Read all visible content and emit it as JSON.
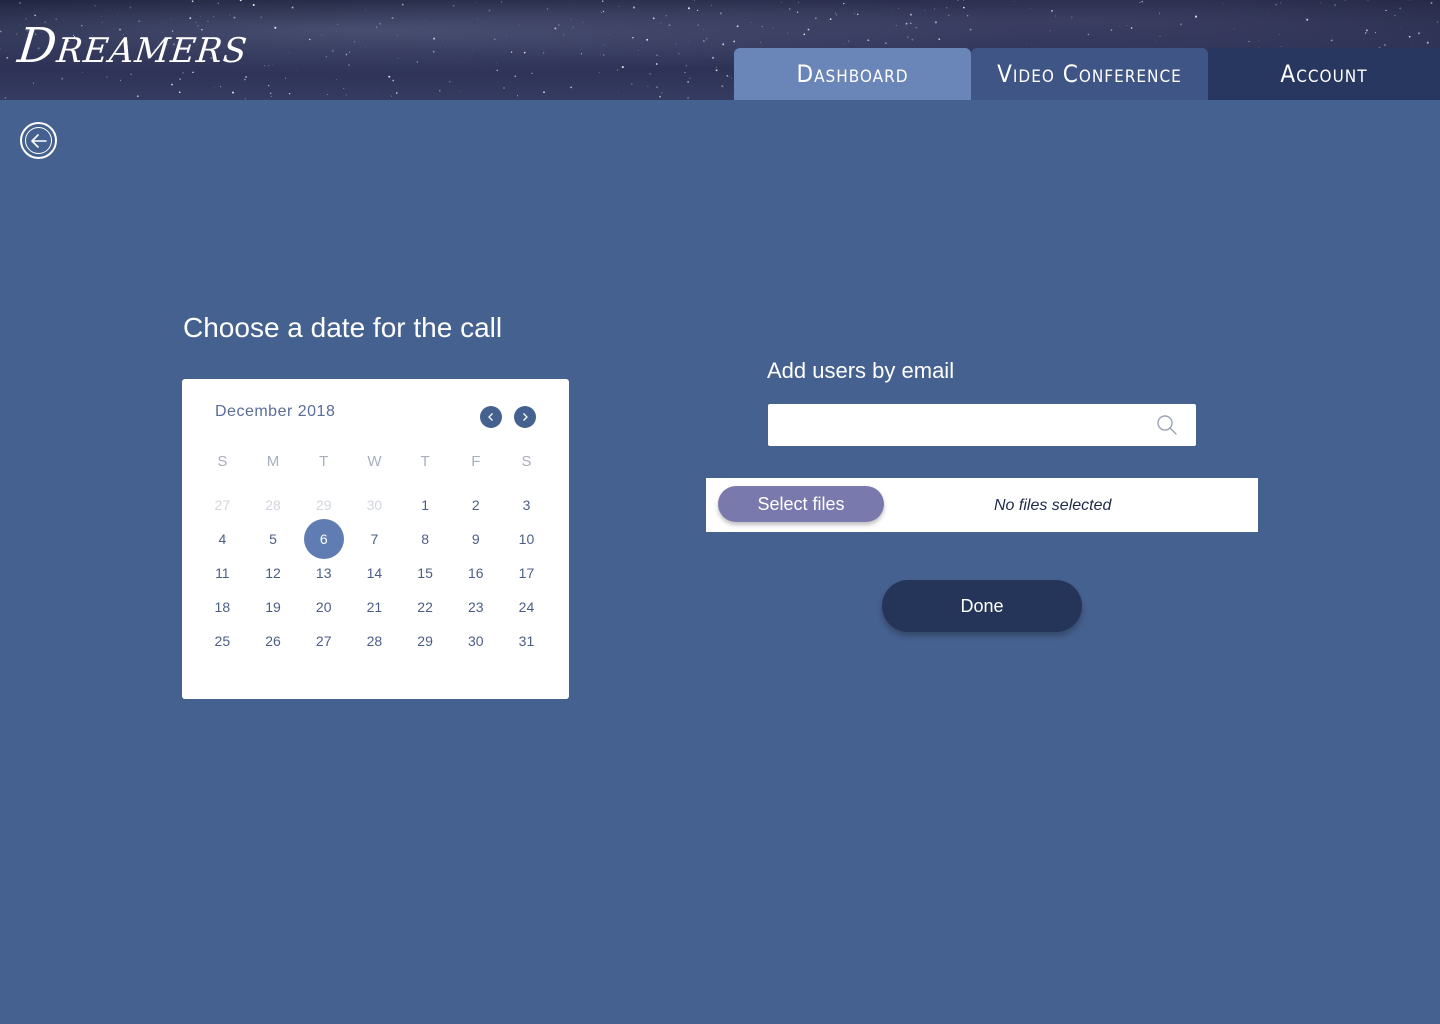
{
  "header": {
    "logo": "Dreamers",
    "nav": [
      {
        "label": "Dashboard",
        "active": true
      },
      {
        "label": "Video Conference",
        "active": false
      },
      {
        "label": "Account",
        "active": false
      }
    ]
  },
  "icons": {
    "back": "arrow-left-circle-icon",
    "prev": "chevron-left-icon",
    "next": "chevron-right-icon",
    "search": "search-icon"
  },
  "date_section": {
    "title": "Choose a date for the call",
    "calendar": {
      "month_label": "December 2018",
      "weekdays": [
        "S",
        "M",
        "T",
        "W",
        "T",
        "F",
        "S"
      ],
      "selected_day": 6,
      "weeks": [
        [
          "27",
          "28",
          "29",
          "30",
          "1",
          "2",
          "3"
        ],
        [
          "4",
          "5",
          "6",
          "7",
          "8",
          "9",
          "10"
        ],
        [
          "11",
          "12",
          "13",
          "14",
          "15",
          "16",
          "17"
        ],
        [
          "18",
          "19",
          "20",
          "21",
          "22",
          "23",
          "24"
        ],
        [
          "25",
          "26",
          "27",
          "28",
          "29",
          "30",
          "31"
        ]
      ],
      "muted_first_week": [
        "27",
        "28",
        "29",
        "30"
      ]
    }
  },
  "users_section": {
    "title": "Add users by email",
    "email_value": "",
    "email_placeholder": ""
  },
  "files": {
    "button_label": "Select files",
    "status": "No files selected"
  },
  "actions": {
    "done_label": "Done"
  },
  "colors": {
    "background": "#45618f",
    "tab_dashboard": "#6a86b8",
    "tab_video": "#3f5585",
    "tab_account": "#28375f",
    "select_button": "#7a79ad",
    "done_button": "#253559",
    "selected_day": "#5f7cb3"
  }
}
